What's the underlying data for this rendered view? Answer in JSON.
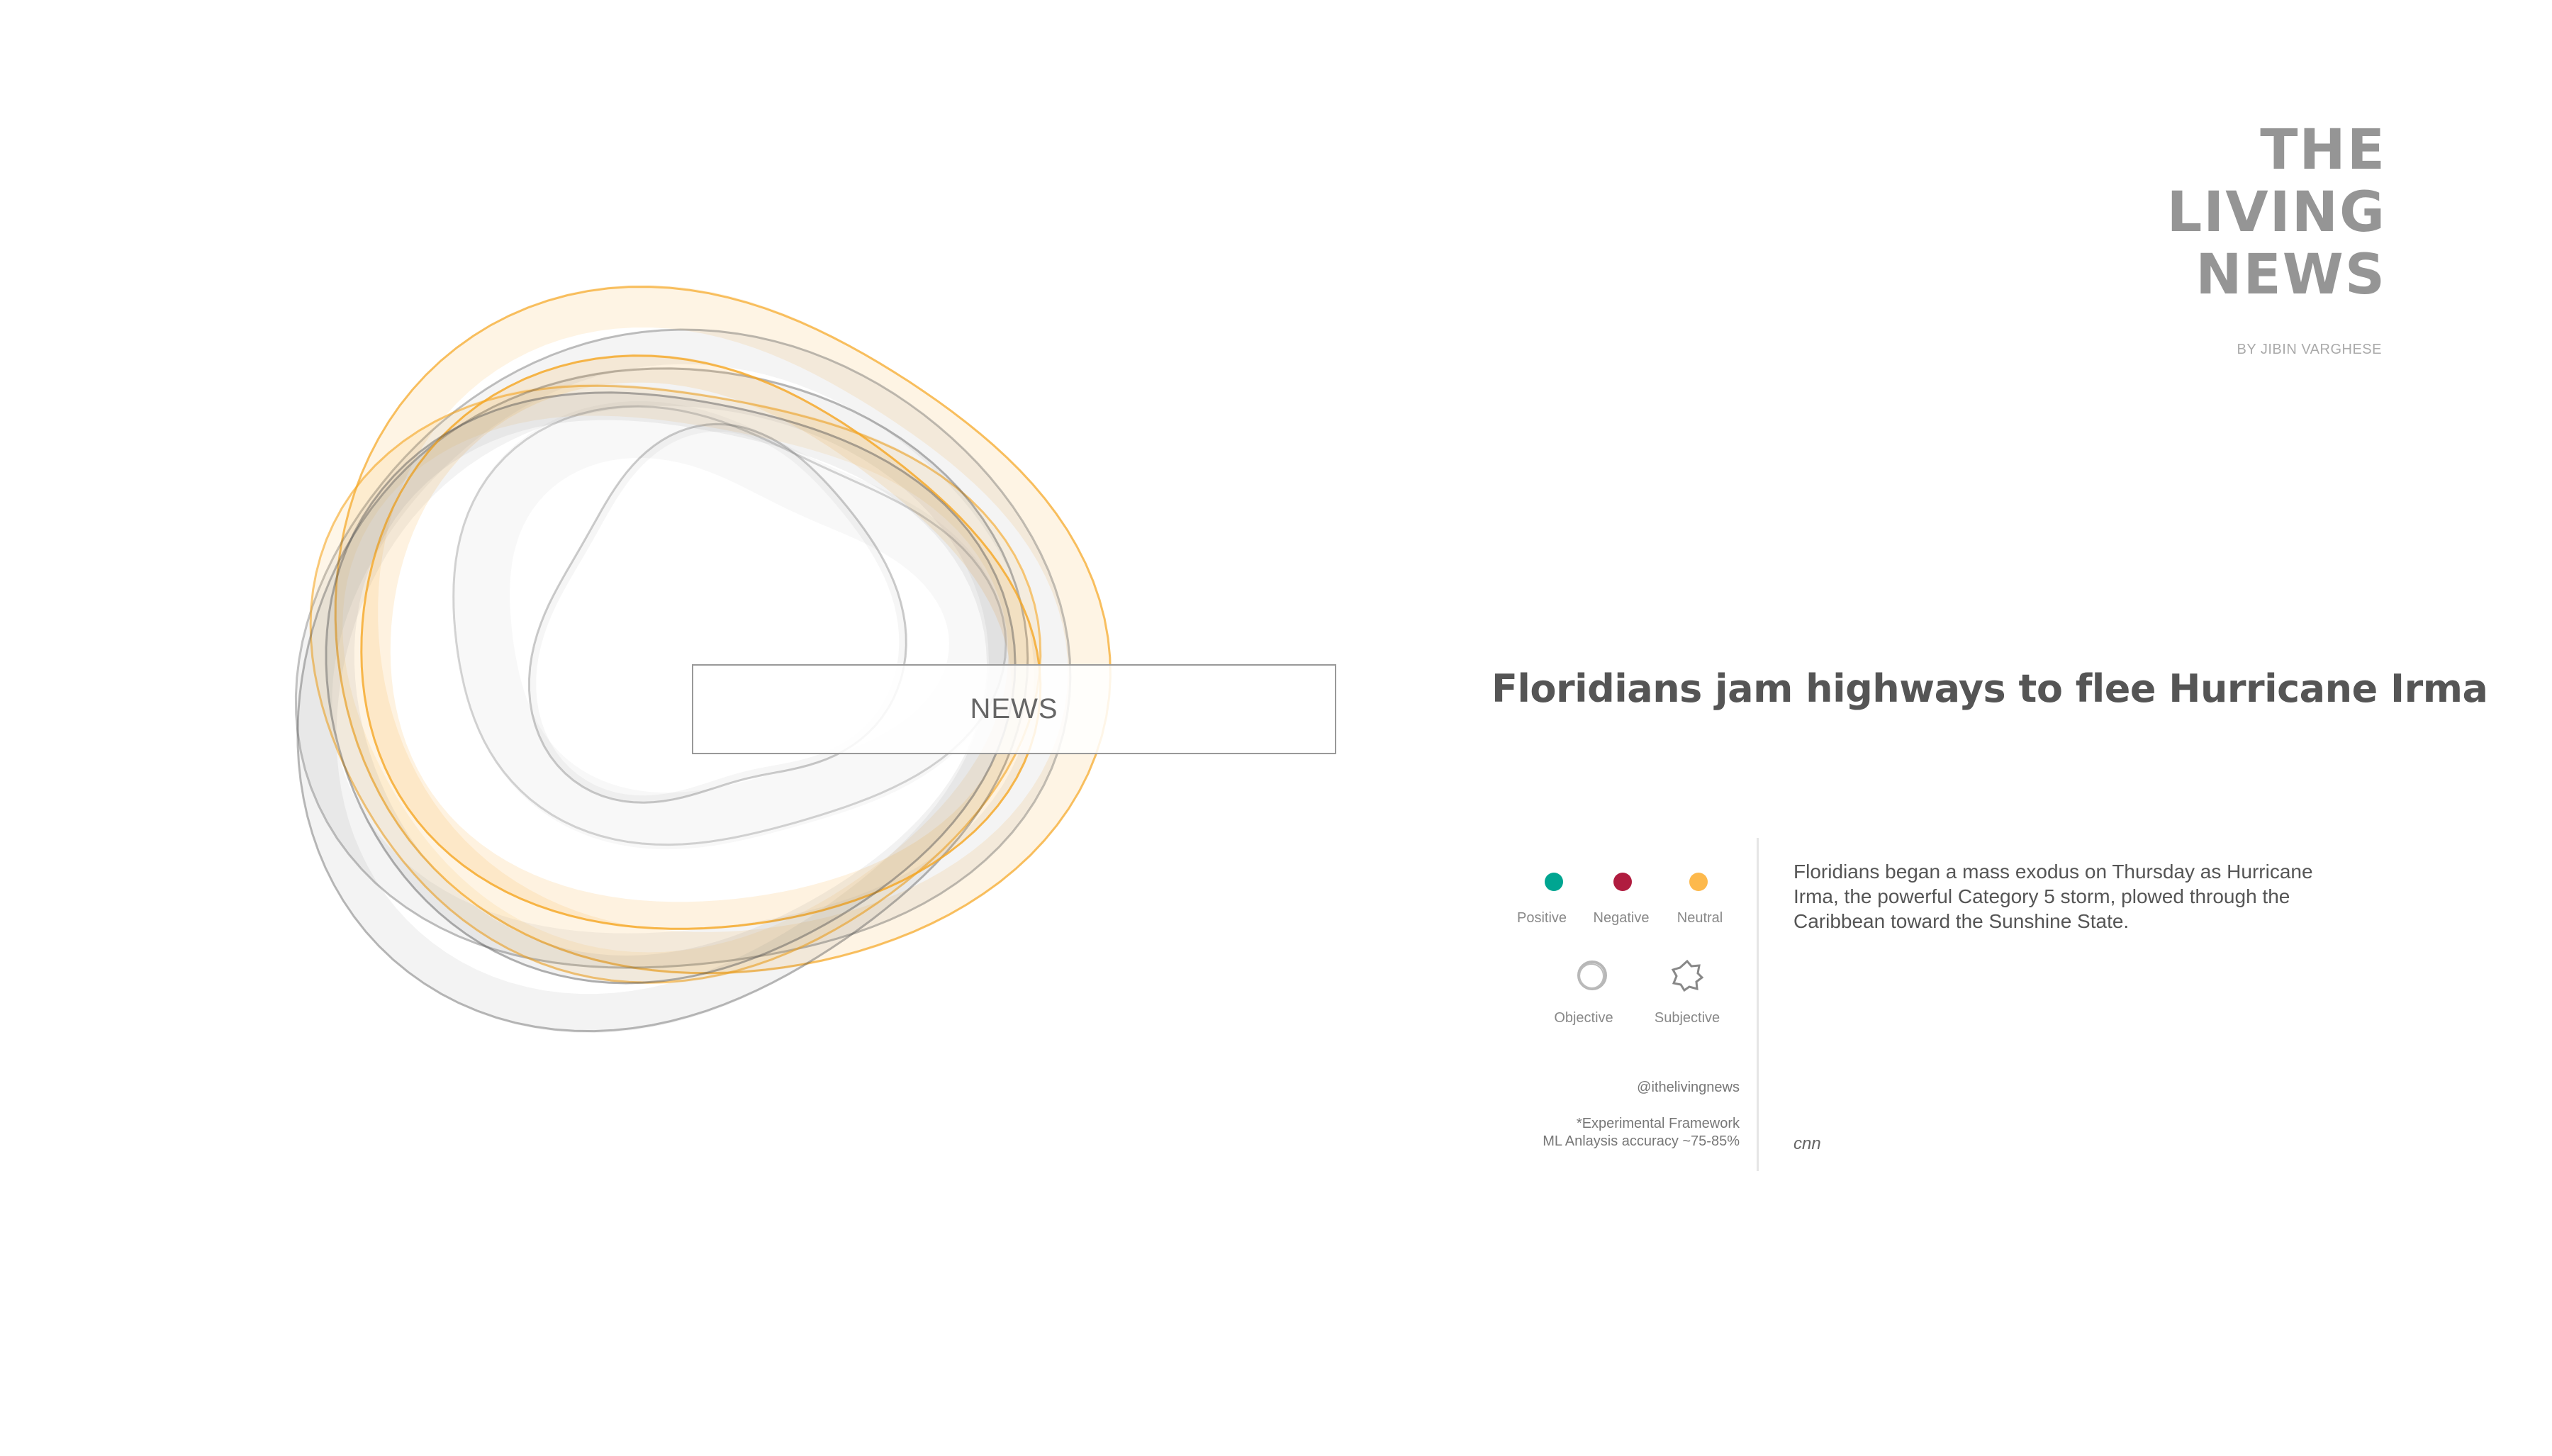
{
  "brand": {
    "line1": "THE",
    "line2": "LIVING",
    "line3": "NEWS",
    "byline": "BY JIBIN VARGHESE"
  },
  "center_label": "NEWS",
  "headline": "Floridians jam highways to flee Hurricane Irma",
  "legend": {
    "sentiment": [
      {
        "label": "Positive",
        "color": "#00a591"
      },
      {
        "label": "Negative",
        "color": "#b01c3f"
      },
      {
        "label": "Neutral",
        "color": "#fdb94c"
      }
    ],
    "style": [
      {
        "label": "Objective",
        "icon": "smooth-ring-icon"
      },
      {
        "label": "Subjective",
        "icon": "jagged-ring-icon"
      }
    ]
  },
  "handle": "@ithelivingnews",
  "disclaimer": {
    "line1": "*Experimental Framework",
    "line2": "ML Anlaysis accuracy ~75-85%"
  },
  "description": "Floridians began a mass exodus on Thursday as Hurricane Irma, the powerful Category 5 storm, plowed through the Caribbean toward the Sunshine State.",
  "source": "cnn",
  "colors": {
    "neutral": "#f5a623",
    "objective": "#555555"
  }
}
